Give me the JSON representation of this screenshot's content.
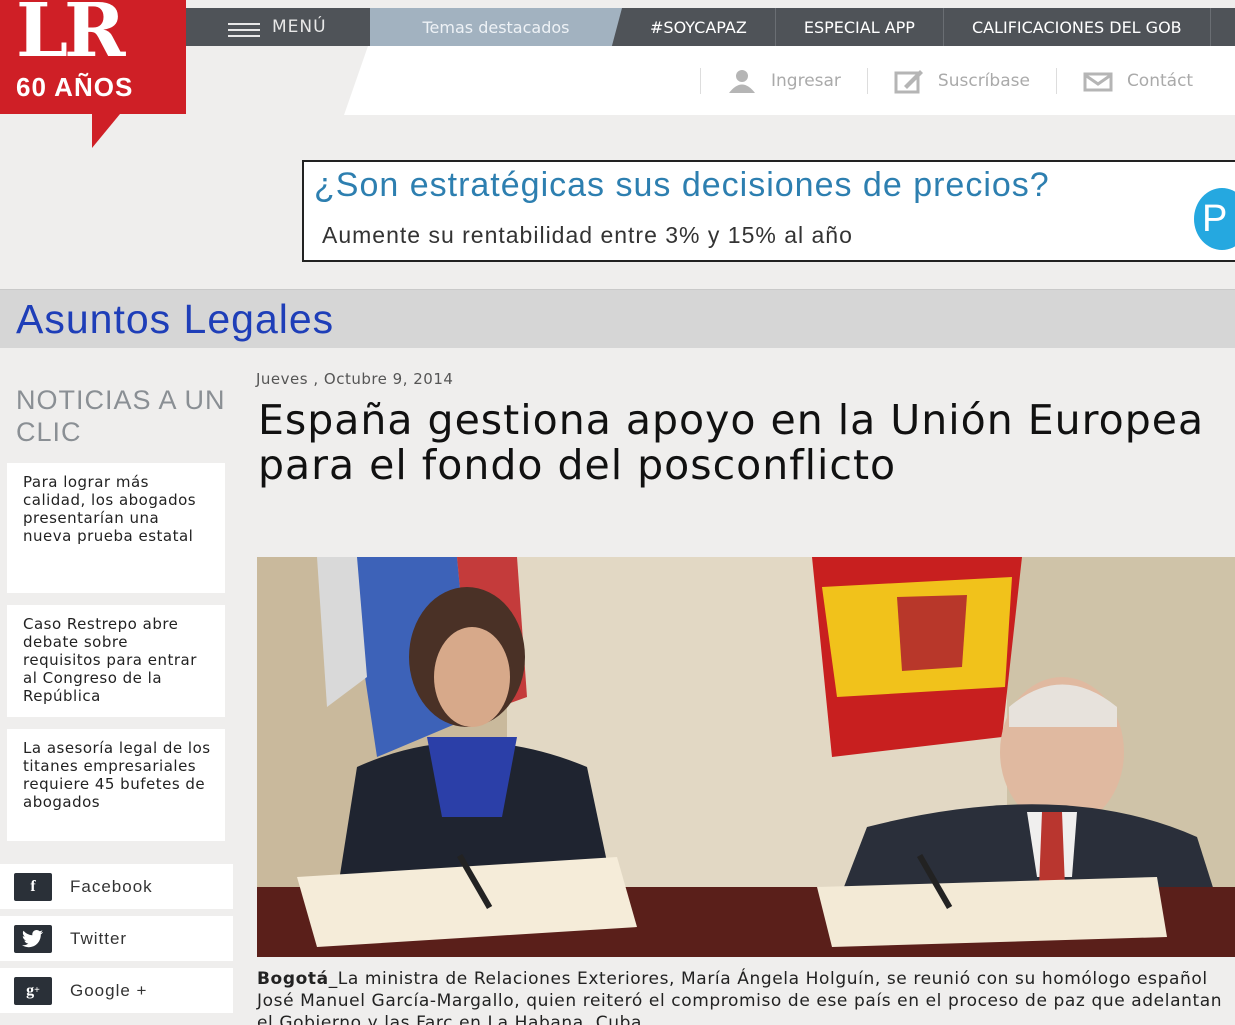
{
  "brand": {
    "logo_text": "LR",
    "anniversary": "60 AÑOS"
  },
  "nav": {
    "menu_label": "MENÚ",
    "topics": [
      "Temas destacados",
      "#SOYCAPAZ",
      "ESPECIAL APP",
      "CALIFICACIONES DEL GOB"
    ]
  },
  "utils": {
    "login": "Ingresar",
    "subscribe": "Suscríbase",
    "contact": "Contáct"
  },
  "ad": {
    "headline": "¿Son estratégicas sus decisiones de precios?",
    "subline": "Aumente su rentabilidad entre 3% y 15% al año",
    "badge": "P"
  },
  "section": {
    "title": "Asuntos Legales"
  },
  "sidebar": {
    "title": "NOTICIAS A UN CLIC",
    "items": [
      "Para lograr más calidad, los abogados presentarían una nueva prueba estatal",
      "Caso Restrepo abre debate sobre requisitos para entrar al Congreso de la República",
      "La asesoría legal de los titanes empresariales requiere 45 bufetes de abogados"
    ],
    "social": [
      "Facebook",
      "Twitter",
      "Google +"
    ]
  },
  "article": {
    "date": "Jueves , Octubre 9, 2014",
    "headline": "España gestiona apoyo en la Unión Europea para el fondo del posconflicto",
    "lead_place": "Bogotá",
    "lead_text": "_La ministra de Relaciones Exteriores, María Ángela Holguín, se reunió con su homólogo español José Manuel García-Margallo, quien reiteró el compromiso de ese país en el proceso de paz que adelantan el Gobierno y las Farc en La Habana, Cuba."
  },
  "colors": {
    "brand_red": "#cf1f26",
    "section_blue": "#1e3eb8",
    "nav_dark": "#4f5358"
  }
}
